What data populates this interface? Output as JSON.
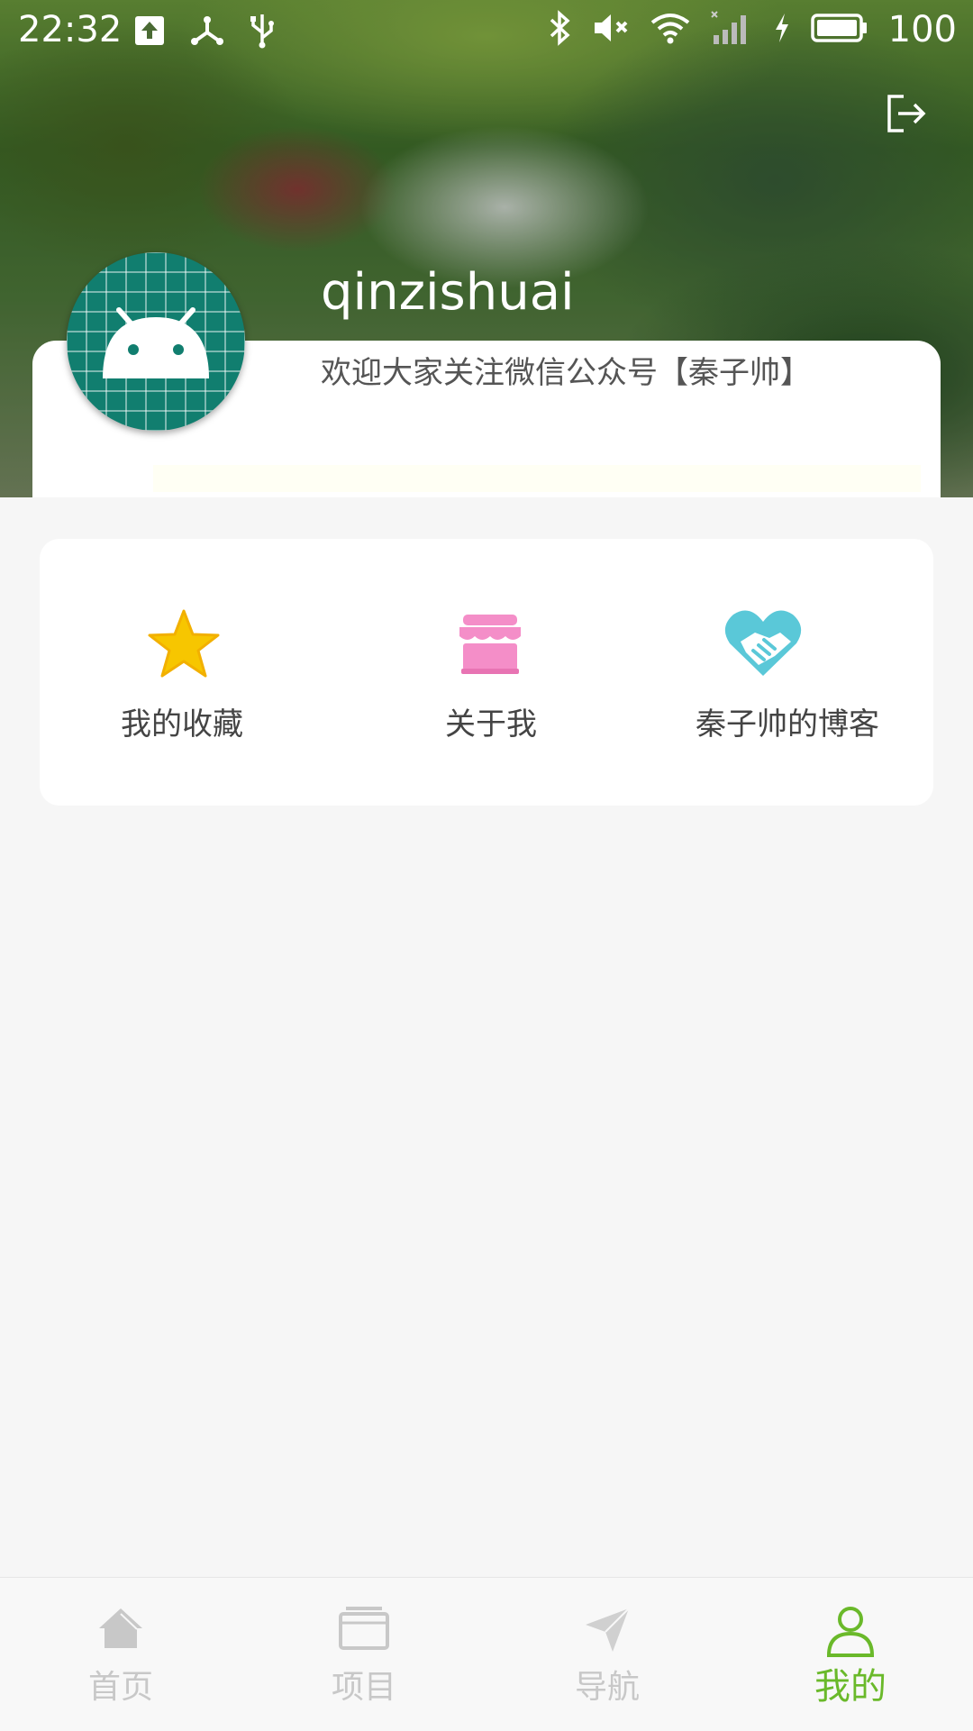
{
  "status_bar": {
    "time": "22:32",
    "battery": "100",
    "icons": [
      "upload-icon",
      "hotspot-icon",
      "usb-icon",
      "bluetooth-icon",
      "mute-icon",
      "wifi-icon",
      "signal-icon",
      "charging-icon",
      "battery-icon"
    ]
  },
  "header": {
    "logout_icon": "logout-icon"
  },
  "profile": {
    "username": "qinzishuai",
    "motto": "欢迎大家关注微信公众号【秦子帅】",
    "avatar_icon": "android-icon"
  },
  "menu": {
    "items": [
      {
        "label": "我的收藏",
        "icon": "star-icon",
        "color": "#f7c600"
      },
      {
        "label": "关于我",
        "icon": "shop-icon",
        "color": "#f48ec8"
      },
      {
        "label": "秦子帅的博客",
        "icon": "handshake-heart-icon",
        "color": "#5ac8d8"
      }
    ]
  },
  "bottom_nav": {
    "items": [
      {
        "label": "首页",
        "icon": "home-icon",
        "active": false
      },
      {
        "label": "项目",
        "icon": "project-icon",
        "active": false
      },
      {
        "label": "导航",
        "icon": "navigation-icon",
        "active": false
      },
      {
        "label": "我的",
        "icon": "person-icon",
        "active": true
      }
    ],
    "active_color": "#6ab92a",
    "inactive_color": "#c8c8c8"
  }
}
